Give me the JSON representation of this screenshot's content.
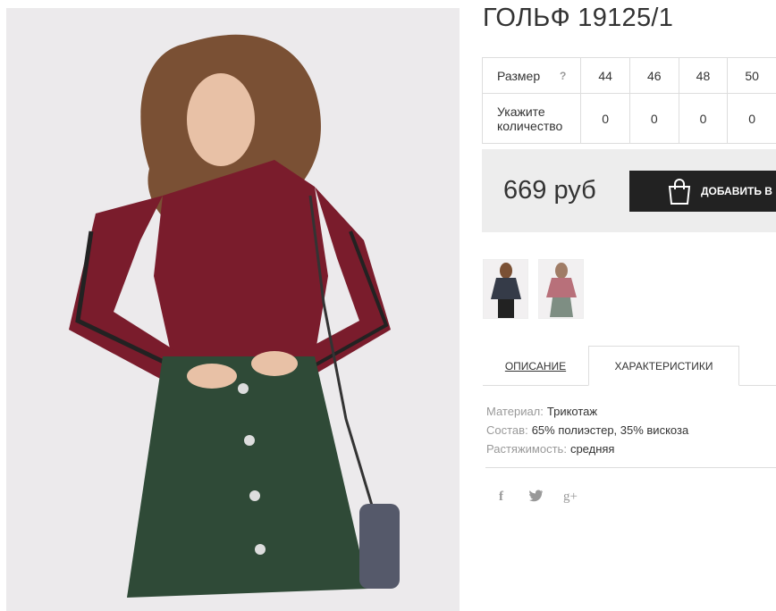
{
  "product": {
    "title": "ГОЛЬФ 19125/1",
    "price": "669 руб",
    "add_to_cart_label": "ДОБАВИТЬ В"
  },
  "size_table": {
    "size_label": "Размер",
    "help_icon": "?",
    "qty_label": "Укажите количество",
    "sizes": [
      "44",
      "46",
      "48",
      "50"
    ],
    "quantities": [
      "0",
      "0",
      "0",
      "0"
    ]
  },
  "tabs": {
    "description": "ОПИСАНИЕ",
    "characteristics": "ХАРАКТЕРИСТИКИ",
    "active": "characteristics"
  },
  "characteristics": [
    {
      "key": "Материал:",
      "value": "Трикотаж"
    },
    {
      "key": "Состав:",
      "value": "65% полиэстер, 35% вискоза"
    },
    {
      "key": "Растяжимость:",
      "value": "средняя"
    }
  ],
  "social": {
    "facebook": "f",
    "twitter": "🐦",
    "googleplus": "g+"
  },
  "icons": [
    "shopping-bag-icon",
    "facebook-icon",
    "twitter-icon",
    "google-plus-icon",
    "help-icon"
  ],
  "colors": {
    "button_bg": "#222222",
    "price_bg": "#ededed",
    "top_color": "#7a1c2c",
    "skirt_color": "#2f4a37"
  }
}
